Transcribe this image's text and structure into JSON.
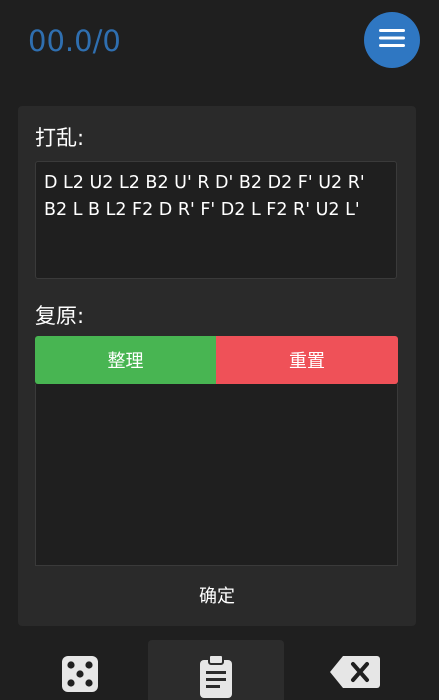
{
  "header": {
    "score": "00.0/0",
    "menu_icon": "hamburger-menu-icon"
  },
  "scramble": {
    "label": "打乱:",
    "text": "D L2 U2 L2 B2 U' R D' B2 D2 F' U2 R' B2 L B L2 F2 D R' F' D2 L F2 R' U2 L'"
  },
  "solve": {
    "label": "复原:",
    "tidy_button": "整理",
    "reset_button": "重置",
    "confirm_button": "确定"
  },
  "colors": {
    "accent_blue": "#2f77c2",
    "tidy_green": "#48b552",
    "reset_red": "#ef5158"
  },
  "bottom_nav": {
    "items": [
      {
        "icon": "dice-icon"
      },
      {
        "icon": "clipboard-icon"
      },
      {
        "icon": "backspace-icon"
      }
    ]
  }
}
